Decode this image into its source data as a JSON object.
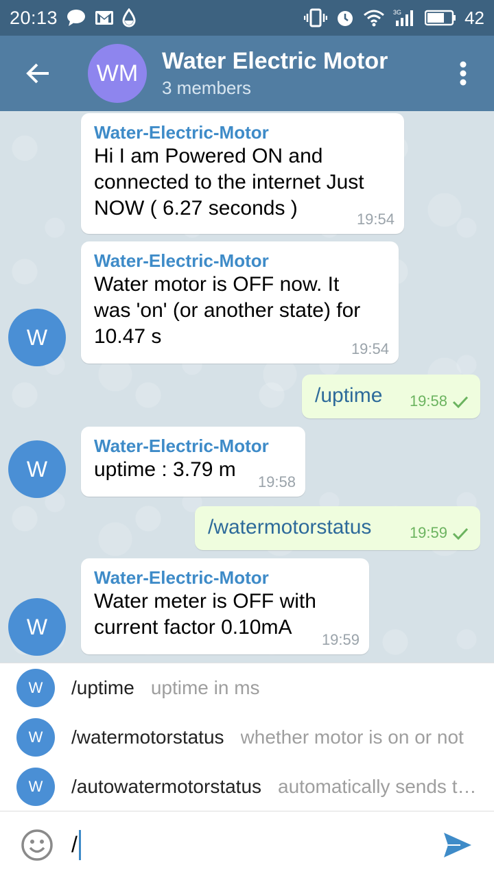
{
  "status_bar": {
    "time": "20:13",
    "network": "3G",
    "battery": "42",
    "icons": [
      "chat-icon",
      "gmail-icon",
      "water-drop-icon",
      "vibrate-icon",
      "alarm-icon",
      "wifi-icon",
      "signal-icon",
      "battery-icon"
    ]
  },
  "header": {
    "avatar_initials": "WM",
    "title": "Water Electric Motor",
    "subtitle": "3 members"
  },
  "messages": [
    {
      "sender": "Water-Electric-Motor",
      "lines": [
        "Hi I am Powered ON and",
        "connected to the internet Just",
        "NOW ( 6.27 seconds )"
      ],
      "time": "19:54"
    },
    {
      "sender": "Water-Electric-Motor",
      "avatar": "W",
      "lines": [
        "Water motor is OFF now. It",
        "was 'on' (or another state) for",
        "10.47 s"
      ],
      "time": "19:54"
    },
    {
      "text": "/uptime",
      "time": "19:58",
      "outgoing": true
    },
    {
      "sender": "Water-Electric-Motor",
      "avatar": "W",
      "lines": [
        "uptime : 3.79 m"
      ],
      "time": "19:58"
    },
    {
      "text": "/watermotorstatus",
      "time": "19:59",
      "outgoing": true
    },
    {
      "sender": "Water-Electric-Motor",
      "avatar": "W",
      "lines": [
        "Water meter is OFF with",
        "current factor 0.10mA"
      ],
      "time": "19:59"
    }
  ],
  "commands": [
    {
      "avatar": "W",
      "name": "/uptime",
      "description": "uptime in ms"
    },
    {
      "avatar": "W",
      "name": "/watermotorstatus",
      "description": "whether motor is on or not"
    },
    {
      "avatar": "W",
      "name": "/autowatermotorstatus",
      "description": "automatically sends the status"
    }
  ],
  "input": {
    "value": "/"
  },
  "colors": {
    "status_bar": "#3d6280",
    "header": "#517da2",
    "group_avatar": "#8e85ee",
    "bot_avatar": "#4a8fd5",
    "sender": "#3e8bc8",
    "outgoing_bubble": "#effdde",
    "read_check": "#6bb35f"
  }
}
